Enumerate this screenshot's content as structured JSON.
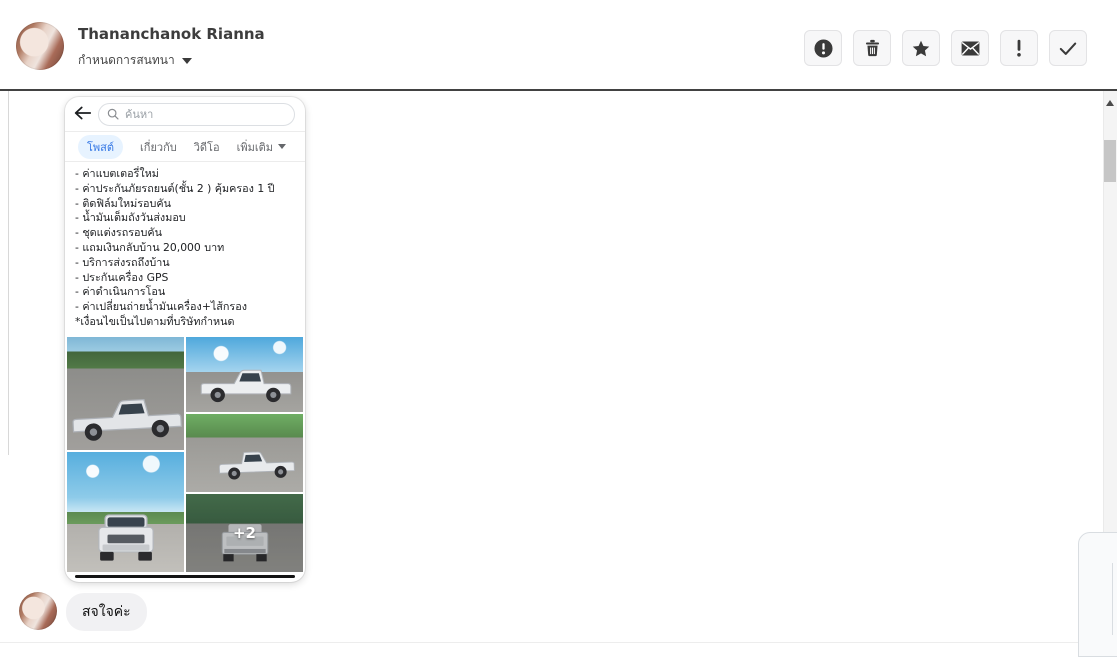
{
  "header": {
    "name": "Thananchanok Rianna",
    "subtitle": "กำหนดการสนทนา",
    "action_icons": [
      "alert-circle",
      "trash",
      "star",
      "envelope",
      "exclamation",
      "check"
    ]
  },
  "embed": {
    "search_placeholder": "ค้นหา",
    "tabs": [
      {
        "label": "โพสต์",
        "active": true
      },
      {
        "label": "เกี่ยวกับ",
        "active": false
      },
      {
        "label": "วิดีโอ",
        "active": false
      },
      {
        "label": "เพิ่มเติม",
        "active": false,
        "has_caret": true
      }
    ],
    "post_lines": [
      "- ค่าแบตเตอรี่ใหม่",
      "- ค่าประกันภัยรถยนต์(ชั้น 2 ) คุ้มครอง 1 ปี",
      "- ติดฟิล์มใหม่รอบคัน",
      "- น้ำมันเต็มถังวันส่งมอบ",
      "- ชุดแต่งรถรอบคัน",
      "- แถมเงินกลับบ้าน 20,000 บาท",
      "- บริการส่งรถถึงบ้าน",
      "- ประกันเครื่อง GPS",
      "- ค่าดำเนินการโอน",
      "- ค่าเปลี่ยนถ่ายน้ำมันเครื่อง+ไส้กรอง",
      "*เงื่อนไขเป็นไปตามที่บริษัทกำหนด"
    ],
    "photo_count_overlay": "+2"
  },
  "message": {
    "text": "สจใจค่ะ"
  },
  "colors": {
    "accent_blue": "#3578e5",
    "tab_pill_bg": "#e7f3ff",
    "bubble_bg": "#f1f1f3",
    "header_border": "#424242",
    "icon_dark": "#3a3a3a"
  }
}
